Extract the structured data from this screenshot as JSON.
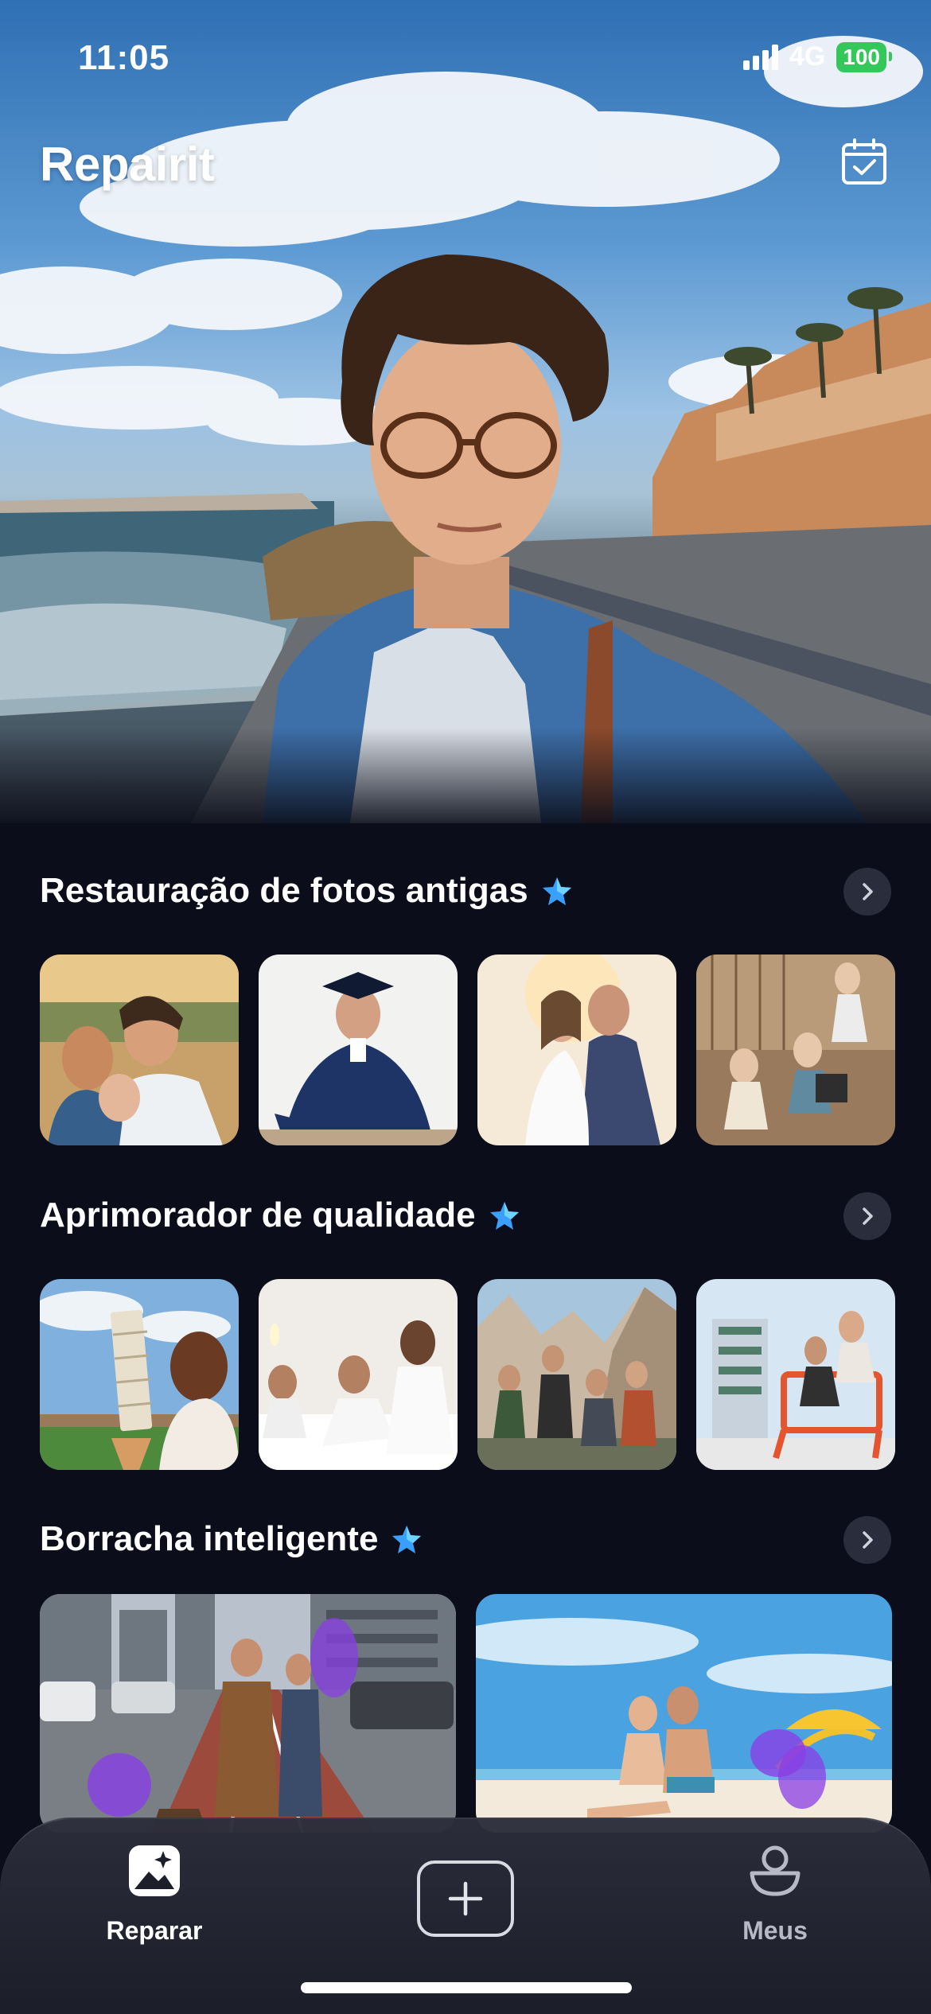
{
  "status_bar": {
    "time": "11:05",
    "network": "4G",
    "battery": "100"
  },
  "app": {
    "title": "Repairit"
  },
  "sections": [
    {
      "title": "Restauração de fotos antigas"
    },
    {
      "title": "Aprimorador de qualidade"
    },
    {
      "title": "Borracha inteligente"
    }
  ],
  "nav": {
    "repair_label": "Reparar",
    "mine_label": "Meus"
  },
  "colors": {
    "background": "#0b0e1a",
    "accent_star": "#3aa0ff",
    "battery": "#34c759"
  },
  "icons": {
    "calendar": "calendar-check-icon",
    "star": "sparkle-star-icon",
    "chevron": "chevron-right-icon",
    "repair": "photo-magic-icon",
    "add": "plus-icon",
    "mine": "user-icon"
  }
}
